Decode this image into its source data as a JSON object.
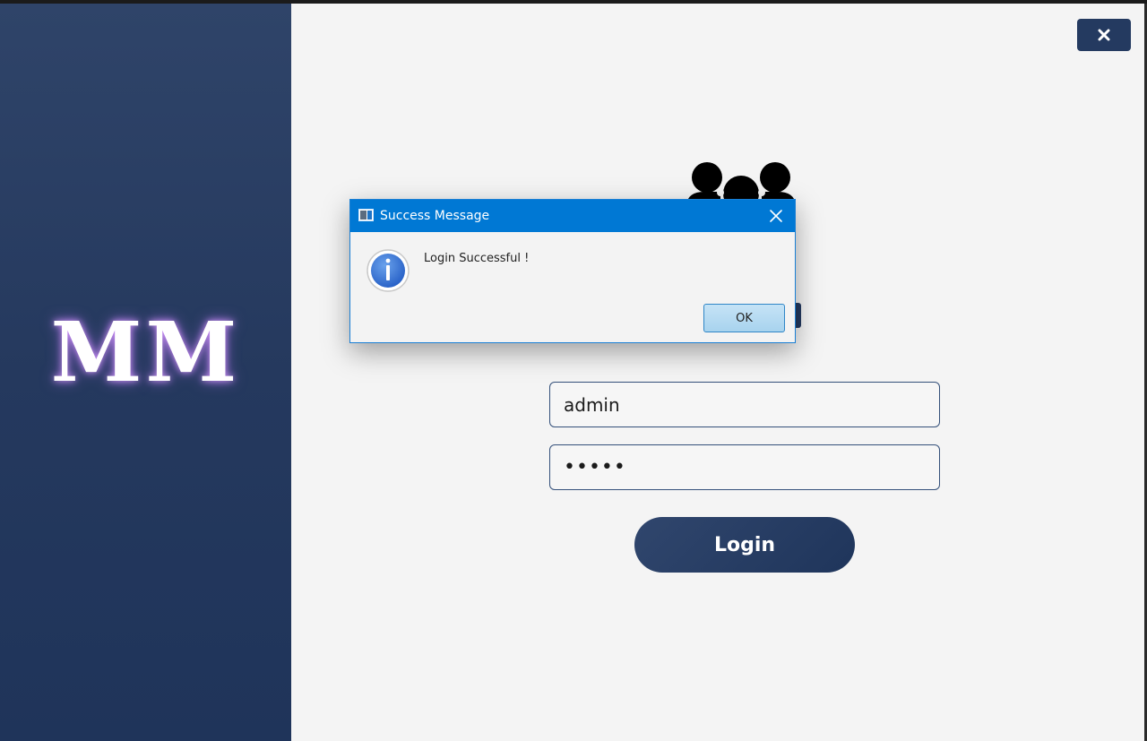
{
  "app": {
    "logo_text": "MM",
    "close_icon": "close-x-icon",
    "users_icon": "users-group-icon",
    "login_label": "Login"
  },
  "form": {
    "username_value": "admin",
    "password_value": "•••••"
  },
  "dialog": {
    "title": "Success Message",
    "message": "Login Successful !",
    "ok_label": "OK",
    "icon": "info-icon"
  },
  "colors": {
    "sidebar": "#27395e",
    "accent": "#243a60",
    "dialog_titlebar": "#0078d4",
    "main_bg": "#f4f4f4"
  }
}
